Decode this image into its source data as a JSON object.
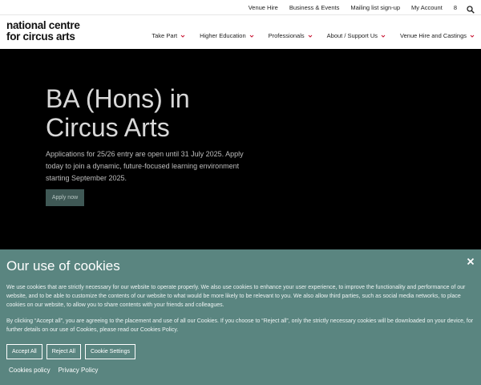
{
  "topbar": {
    "links": [
      "Venue Hire",
      "Business & Events",
      "Mailing list sign-up",
      "My Account"
    ],
    "extra": "8",
    "search_icon": "search-icon"
  },
  "logo": {
    "line1": "national centre",
    "line2": "for circus arts"
  },
  "nav": {
    "items": [
      "Take Part",
      "Higher Education",
      "Professionals",
      "About / Support Us",
      "Venue Hire and Castings"
    ]
  },
  "hero": {
    "title_line1": "BA (Hons) in",
    "title_line2": "Circus Arts",
    "text": "Applications for 25/26 entry are open until 31 July 2025. Apply today to join a dynamic, future-focused learning environment starting September 2025.",
    "button": "Apply now"
  },
  "cookie": {
    "title": "Our use of cookies",
    "p1": "We use cookies that are strictly necessary for our website to operate properly. We also use cookies to enhance your user experience, to improve the functionality and performance of our website, and to be able to customize the contents of our website to what would be more likely to be relevant to you. We also allow third parties, such as social media networks, to place cookies on our website, to allow you to share contents with your friends and colleagues.",
    "p2": "By clicking “Accept all”, you are agreeing to the placement and use of all our Cookies. If you choose to “Reject all”, only the strictly necessary cookies will be downloaded on your device, for further details on our use of Cookies, please read our Cookies Policy.",
    "accept": "Accept All",
    "reject": "Reject All",
    "settings": "Cookie Settings",
    "policy_link": "Cookies policy",
    "privacy_link": "Privacy Policy"
  },
  "colors": {
    "cookie_bg": "#5a8580",
    "apply_bg": "#3f5855",
    "nav_chevron": "#c8102e"
  }
}
